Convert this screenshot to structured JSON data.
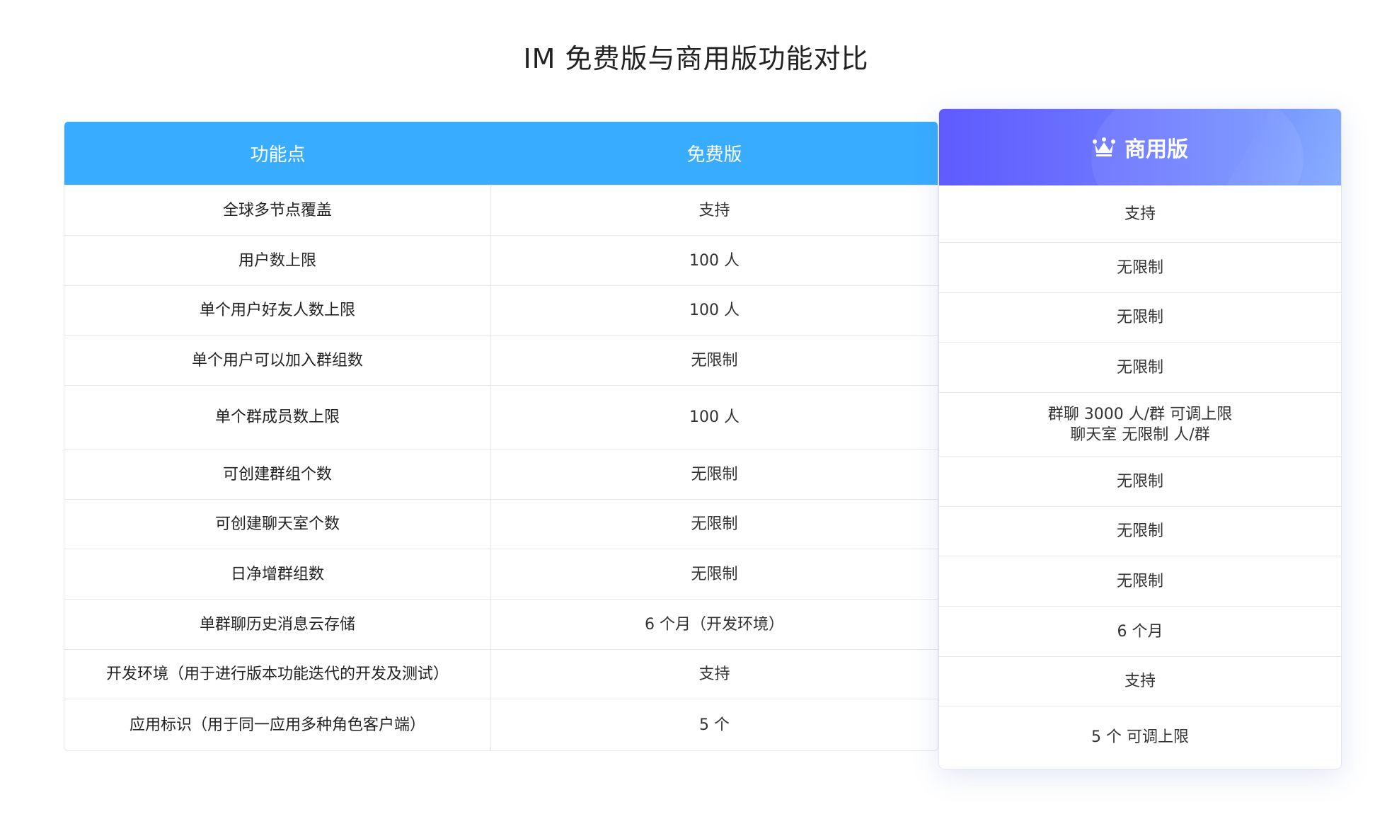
{
  "title": "IM 免费版与商用版功能对比",
  "header": {
    "feature": "功能点",
    "free": "免费版",
    "pro": "商用版",
    "pro_icon": "crown-icon"
  },
  "rows": [
    {
      "feature": "全球多节点覆盖",
      "free": "支持",
      "pro": "支持"
    },
    {
      "feature": "用户数上限",
      "free": "100 人",
      "pro": "无限制"
    },
    {
      "feature": "单个用户好友人数上限",
      "free": "100 人",
      "pro": "无限制"
    },
    {
      "feature": "单个用户可以加入群组数",
      "free": "无限制",
      "pro": "无限制"
    },
    {
      "feature": "单个群成员数上限",
      "free": "100 人",
      "pro": "群聊 3000 人/群 可调上限",
      "pro_line2": "聊天室 无限制 人/群"
    },
    {
      "feature": "可创建群组个数",
      "free": "无限制",
      "pro": "无限制"
    },
    {
      "feature": "可创建聊天室个数",
      "free": "无限制",
      "pro": "无限制"
    },
    {
      "feature": "日净增群组数",
      "free": "无限制",
      "pro": "无限制"
    },
    {
      "feature": "单群聊历史消息云存储",
      "free": "6 个月（开发环境）",
      "pro": "6 个月"
    },
    {
      "feature": "开发环境（用于进行版本功能迭代的开发及测试）",
      "free": "支持",
      "pro": "支持"
    },
    {
      "feature": "应用标识（用于同一应用多种角色客户端）",
      "free": "5 个",
      "pro": "5 个 可调上限"
    }
  ],
  "colors": {
    "header_blue": "#38acff",
    "pro_gradient_start": "#5f5bff",
    "pro_gradient_end": "#7aa3ff",
    "border": "#e6e8ec"
  }
}
